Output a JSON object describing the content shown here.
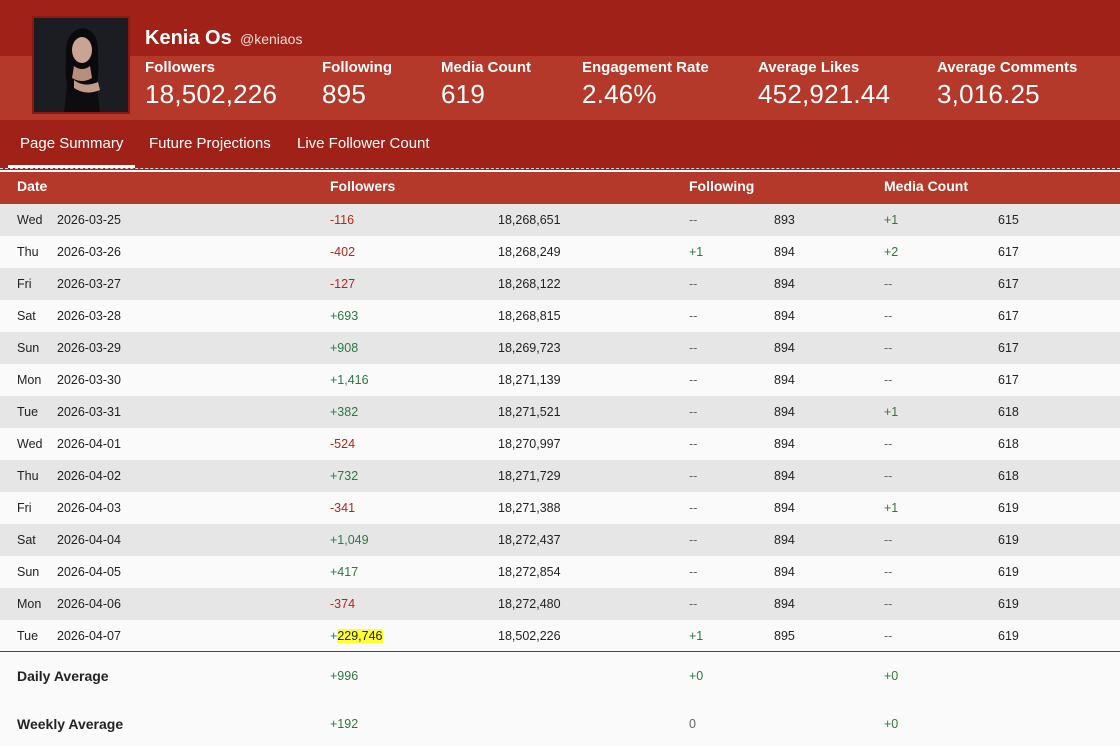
{
  "profile": {
    "name": "Kenia Os",
    "handle": "@keniaos"
  },
  "stats": [
    {
      "label": "Followers",
      "value": "18,502,226"
    },
    {
      "label": "Following",
      "value": "895"
    },
    {
      "label": "Media Count",
      "value": "619"
    },
    {
      "label": "Engagement Rate",
      "value": "2.46%"
    },
    {
      "label": "Average Likes",
      "value": "452,921.44"
    },
    {
      "label": "Average Comments",
      "value": "3,016.25"
    }
  ],
  "tabs": [
    {
      "label": "Page Summary",
      "active": true
    },
    {
      "label": "Future Projections",
      "active": false
    },
    {
      "label": "Live Follower Count",
      "active": false
    }
  ],
  "table": {
    "headers": {
      "date": "Date",
      "followers": "Followers",
      "following": "Following",
      "media": "Media Count"
    },
    "rows": [
      {
        "day": "Wed",
        "date": "2026-03-25",
        "followers_change": "-116",
        "followers_total": "18,268,651",
        "following_change": "--",
        "following_total": "893",
        "media_change": "+1",
        "media_total": "615"
      },
      {
        "day": "Thu",
        "date": "2026-03-26",
        "followers_change": "-402",
        "followers_total": "18,268,249",
        "following_change": "+1",
        "following_total": "894",
        "media_change": "+2",
        "media_total": "617"
      },
      {
        "day": "Fri",
        "date": "2026-03-27",
        "followers_change": "-127",
        "followers_total": "18,268,122",
        "following_change": "--",
        "following_total": "894",
        "media_change": "--",
        "media_total": "617"
      },
      {
        "day": "Sat",
        "date": "2026-03-28",
        "followers_change": "+693",
        "followers_total": "18,268,815",
        "following_change": "--",
        "following_total": "894",
        "media_change": "--",
        "media_total": "617"
      },
      {
        "day": "Sun",
        "date": "2026-03-29",
        "followers_change": "+908",
        "followers_total": "18,269,723",
        "following_change": "--",
        "following_total": "894",
        "media_change": "--",
        "media_total": "617"
      },
      {
        "day": "Mon",
        "date": "2026-03-30",
        "followers_change": "+1,416",
        "followers_total": "18,271,139",
        "following_change": "--",
        "following_total": "894",
        "media_change": "--",
        "media_total": "617"
      },
      {
        "day": "Tue",
        "date": "2026-03-31",
        "followers_change": "+382",
        "followers_total": "18,271,521",
        "following_change": "--",
        "following_total": "894",
        "media_change": "+1",
        "media_total": "618"
      },
      {
        "day": "Wed",
        "date": "2026-04-01",
        "followers_change": "-524",
        "followers_total": "18,270,997",
        "following_change": "--",
        "following_total": "894",
        "media_change": "--",
        "media_total": "618"
      },
      {
        "day": "Thu",
        "date": "2026-04-02",
        "followers_change": "+732",
        "followers_total": "18,271,729",
        "following_change": "--",
        "following_total": "894",
        "media_change": "--",
        "media_total": "618"
      },
      {
        "day": "Fri",
        "date": "2026-04-03",
        "followers_change": "-341",
        "followers_total": "18,271,388",
        "following_change": "--",
        "following_total": "894",
        "media_change": "+1",
        "media_total": "619"
      },
      {
        "day": "Sat",
        "date": "2026-04-04",
        "followers_change": "+1,049",
        "followers_total": "18,272,437",
        "following_change": "--",
        "following_total": "894",
        "media_change": "--",
        "media_total": "619"
      },
      {
        "day": "Sun",
        "date": "2026-04-05",
        "followers_change": "+417",
        "followers_total": "18,272,854",
        "following_change": "--",
        "following_total": "894",
        "media_change": "--",
        "media_total": "619"
      },
      {
        "day": "Mon",
        "date": "2026-04-06",
        "followers_change": "-374",
        "followers_total": "18,272,480",
        "following_change": "--",
        "following_total": "894",
        "media_change": "--",
        "media_total": "619"
      },
      {
        "day": "Tue",
        "date": "2026-04-07",
        "followers_change": "+229,746",
        "followers_total": "18,502,226",
        "following_change": "+1",
        "following_total": "895",
        "media_change": "--",
        "media_total": "619",
        "highlight": true
      }
    ],
    "summary": [
      {
        "label": "Daily Average",
        "followers": "+996",
        "following": "+0",
        "media": "+0"
      },
      {
        "label": "Weekly Average",
        "followers": "+192",
        "following": "0",
        "media": "+0"
      }
    ]
  },
  "colors": {
    "header_dark": "#a02117",
    "header_band": "#b5392b",
    "positive": "#2b7a3d",
    "negative": "#b3261e",
    "highlight": "#ffff33"
  }
}
